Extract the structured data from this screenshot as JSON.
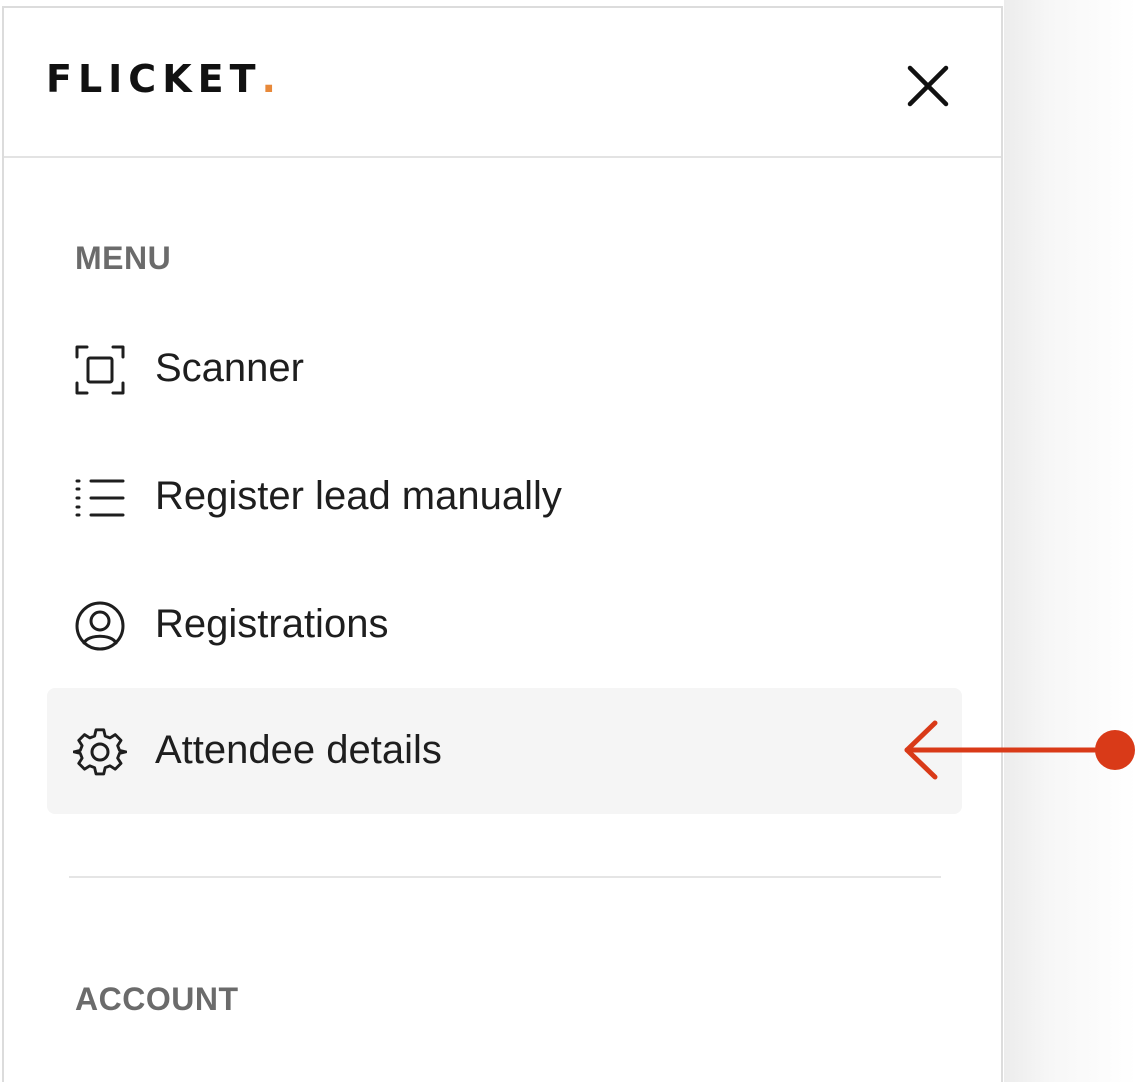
{
  "header": {
    "logo_text": "FLICKET",
    "logo_dot": ".",
    "close_icon": "close-icon"
  },
  "menu": {
    "title": "MENU",
    "items": [
      {
        "label": "Scanner",
        "icon": "scan-icon",
        "active": false
      },
      {
        "label": "Register lead manually",
        "icon": "list-icon",
        "active": false
      },
      {
        "label": "Registrations",
        "icon": "user-circle-icon",
        "active": false
      },
      {
        "label": "Attendee details",
        "icon": "gear-icon",
        "active": true
      }
    ]
  },
  "account": {
    "title": "ACCOUNT"
  },
  "colors": {
    "brand_dot": "#e8893a",
    "active_bg": "#f5f5f5",
    "annotation": "#d93a18",
    "section_title": "#6b6b6b"
  }
}
